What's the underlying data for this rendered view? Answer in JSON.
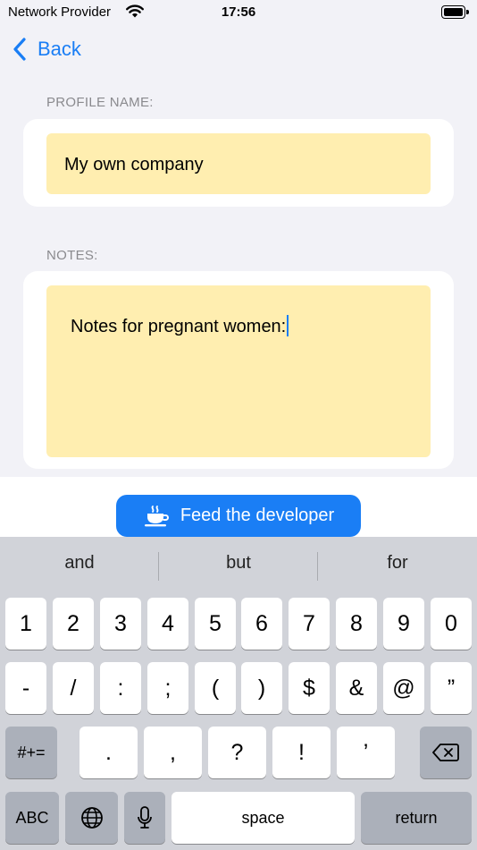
{
  "status_bar": {
    "carrier": "Network Provider",
    "time": "17:56",
    "wifi_icon": "wifi-icon",
    "battery_icon": "battery-icon"
  },
  "nav": {
    "back_label": "Back",
    "back_icon": "chevron-left-icon"
  },
  "profile": {
    "section_label": "PROFILE NAME:",
    "name_value": "My own company"
  },
  "notes": {
    "section_label": "NOTES:",
    "value": "Notes for pregnant women:"
  },
  "feed": {
    "label": "Feed the developer",
    "icon": "coffee-cup-icon"
  },
  "keyboard": {
    "suggestions": [
      "and",
      "but",
      "for"
    ],
    "row1": [
      "1",
      "2",
      "3",
      "4",
      "5",
      "6",
      "7",
      "8",
      "9",
      "0"
    ],
    "row2": [
      "-",
      "/",
      ":",
      ";",
      "(",
      ")",
      "$",
      "&",
      "@",
      "”"
    ],
    "row3": [
      ".",
      ",",
      "?",
      "!",
      "’"
    ],
    "symbols_key": "#+=",
    "abc_key": "ABC",
    "space_key": "space",
    "return_key": "return",
    "backspace_icon": "backspace-icon",
    "globe_icon": "globe-icon",
    "mic_icon": "microphone-icon"
  },
  "colors": {
    "accent": "#1a7ef5",
    "field_background": "#ffeeb0",
    "background": "#f2f2f7",
    "keyboard_background": "#d1d3d9"
  }
}
